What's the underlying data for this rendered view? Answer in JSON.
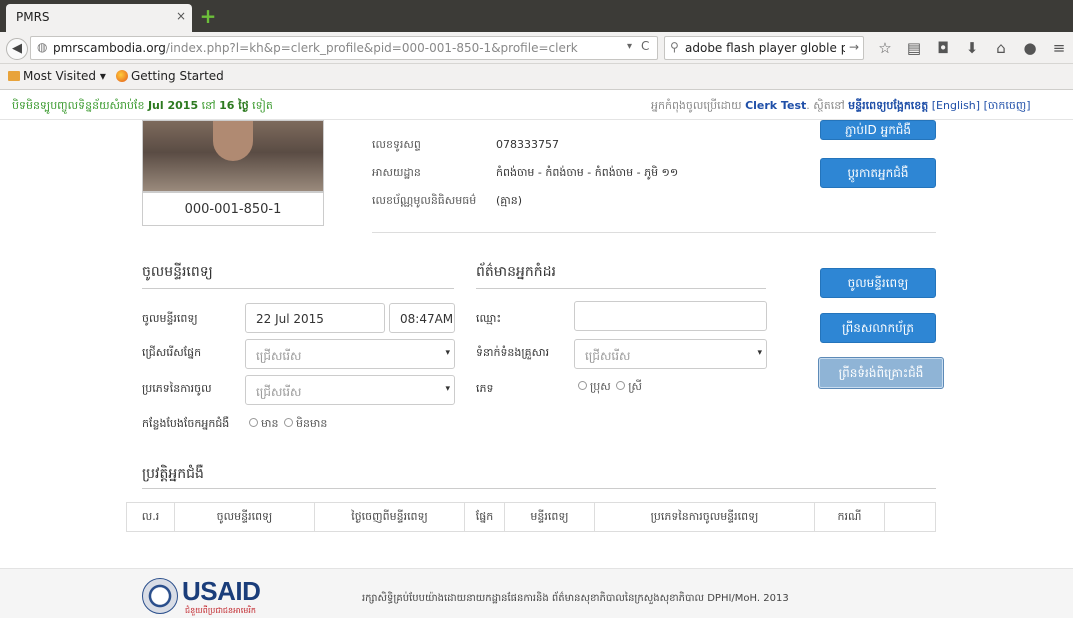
{
  "browser": {
    "tab_title": "PMRS",
    "tab_close": "×",
    "new_tab": "+",
    "url_domain": "pmrscambodia.org",
    "url_path": "/index.php?l=kh&p=clerk_profile&pid=000-001-850-1&profile=clerk",
    "search_text": "adobe flash player globle pri",
    "bookmarks": [
      "Most Visited ▾",
      "Getting Started"
    ]
  },
  "infobar": {
    "left_prefix": "បិទមិនទ្បូបញ្ចូលទិន្នន័យសំរាប់ខែ ",
    "left_month": "Jul 2015",
    "left_mid": " នៅ ",
    "left_days": "16 ថ្ងៃ",
    "left_suffix": " ទៀត",
    "right_prefix": "អ្នកកំពុងចូលប្រើដោយ ",
    "right_user": "Clerk Test",
    "right_mid": ". ស្ថិតនៅ ",
    "right_hospital": "មន្ទីរពេទ្យបង្អែកខេត្ត",
    "right_lang": "[English]",
    "right_logout": "[ចាកចេញ]"
  },
  "profile": {
    "patient_id": "000-001-850-1",
    "phone_label": "លេខទូរសព្ទ",
    "phone": "078333757",
    "address_label": "អាសយដ្ឋាន",
    "address": "កំពង់ចាម - កំពង់ចាម - កំពង់ចាម - ភូមិ ១១",
    "idcard_label": "លេខប័ណ្ណមូលនិធិសមធម៌",
    "idcard": "(គ្មាន)",
    "btn_top": "ភ្ជាប់ID អ្នកជំងឺ",
    "btn_edit": "ប្តូរកាតអ្នកជំងឺ"
  },
  "admission": {
    "title": "ចូលមន្ទីរពេទ្យ",
    "date_label": "ចូលមន្ទីរពេទ្យ",
    "date": "22 Jul 2015",
    "time": "08:47AM",
    "dept_label": "ជ្រើសរើសផ្នែក",
    "dept_placeholder": "ជ្រើសរើស",
    "type_label": "ប្រភេទនៃការចូល",
    "type_placeholder": "ជ្រើសរើស",
    "referral_label": "កន្លែងបែងចែកអ្នកជំងឺ",
    "referral_yes": "មាន",
    "referral_no": "មិនមាន"
  },
  "companion": {
    "title": "ព័ត៌មានអ្នកកំដរ",
    "name_label": "ឈ្មោះ",
    "name_value": "",
    "relation_label": "ទំនាក់ទំនងគ្រួសារ",
    "relation_placeholder": "ជ្រើសរើស",
    "sex_label": "ភេទ",
    "sex_male": "ប្រុស",
    "sex_female": "ស្រី"
  },
  "actions": {
    "admit": "ចូលមន្ទីរពេទ្យ",
    "print_card": "ព្រីនសលាកប័ត្រ",
    "print_sticker": "ព្រីនទំរង់ពិគ្រោះជំងឺ"
  },
  "history": {
    "title": "ប្រវត្តិអ្នកជំងឺ",
    "columns": [
      "ល.រ",
      "ចូលមន្ទីរពេទ្យ",
      "ថ្ងៃចេញពីមន្ទីរពេទ្យ",
      "ផ្នែក",
      "មន្ទីរពេទ្យ",
      "ប្រភេទនៃការចូលមន្ទីរពេទ្យ",
      "ករណី",
      ""
    ]
  },
  "footer": {
    "logo_text": "USAID",
    "logo_sub": "ជំនួយពីប្រជាជនអាមេរិក",
    "credit": "រក្សាសិទ្ធិគ្រប់បែបយ៉ាងដោយនាយកដ្ឋានផែនការនិង ព័ត៌មានសុខាភិបាលនៃក្រសួងសុខាភិបាល DPHI/MoH. 2013"
  }
}
